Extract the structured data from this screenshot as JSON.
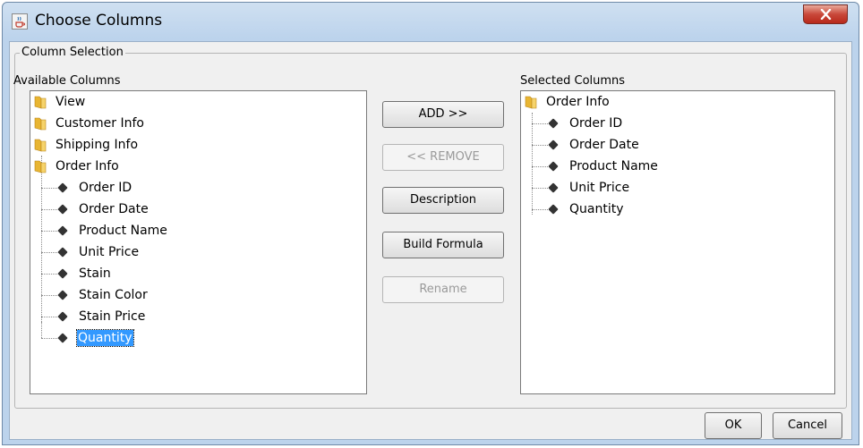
{
  "window": {
    "title": "Choose Columns",
    "close_icon": "close-icon",
    "app_icon": "java-cup-icon"
  },
  "group": {
    "legend": "Column Selection"
  },
  "available": {
    "label": "Available Columns",
    "folders": [
      "View",
      "Customer Info",
      "Shipping Info",
      "Order Info"
    ],
    "children": [
      "Order ID",
      "Order Date",
      "Product Name",
      "Unit Price",
      "Stain",
      "Stain Color",
      "Stain Price",
      "Quantity"
    ],
    "selected_child": "Quantity"
  },
  "selected": {
    "label": "Selected Columns",
    "folder": "Order Info",
    "children": [
      "Order ID",
      "Order Date",
      "Product Name",
      "Unit Price",
      "Quantity"
    ]
  },
  "buttons": {
    "add": "ADD >>",
    "remove": "<< REMOVE",
    "description": "Description",
    "build_formula": "Build Formula",
    "rename": "Rename",
    "ok": "OK",
    "cancel": "Cancel"
  },
  "colors": {
    "selection": "#3399ff",
    "folder": "#e8b532",
    "close": "#c9483a"
  }
}
